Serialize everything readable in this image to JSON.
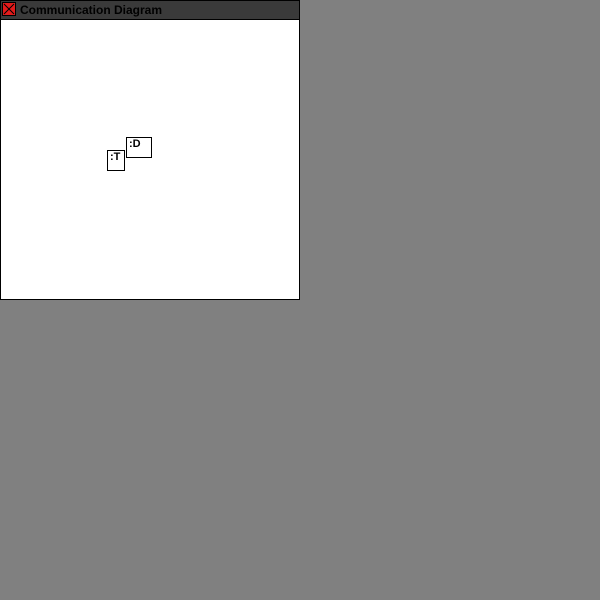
{
  "window": {
    "title": "Communication Diagram",
    "close_icon": "close-icon",
    "colors": {
      "titlebar": "#3a3a3a",
      "close": "#e21b1b",
      "canvas": "#ffffff",
      "desktop": "#808080"
    }
  },
  "diagram": {
    "objects": [
      {
        "label": ":D"
      },
      {
        "label": ":T"
      }
    ]
  }
}
